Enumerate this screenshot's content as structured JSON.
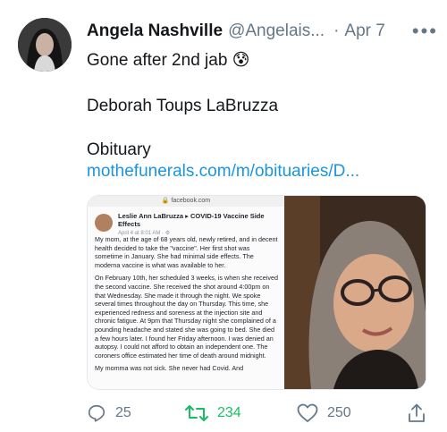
{
  "tweet": {
    "author_name": "Angela Nashville",
    "author_handle": "@Angelais...",
    "separator": "·",
    "date": "Apr 7",
    "more_label": "•••",
    "line1": "Gone after 2nd jab 😰",
    "line2": "Deborah Toups LaBruzza",
    "line3": "Obituary",
    "link_text": "mothefunerals.com/m/obituaries/D..."
  },
  "card": {
    "screenshot": {
      "url_bar": "facebook.com",
      "post_author": "Leslie Ann LaBruzza ▸ COVID-19 Vaccine Side Effects",
      "post_date": "April 4 at 8:01 AM · ⚙",
      "paragraphs": [
        "My mom, at the age of 68 years old, newly retired, and in decent health decided to take the \"vaccine\". Her first shot was sometime in January. She had minimal side effects. The moderna vaccine is what was available to her.",
        "On February 10th, her scheduled 3 weeks, is when she received the second vaccine. She received the shot around 4:00pm on that Wednesday. She made it through the night. We spoke several times throughout the day on Thursday. This time, she experienced redness and soreness at the injection site and chronic fatigue. At 9pm that Thursday night she complained of a pounding headache and stated she was going to bed. She died a few hours later. I found her Friday afternoon. I was denied an autopsy. I could not afford to obtain an independent one. The coroners office estimated her time of death around midnight.",
        "My momma was not sick. She never had Covid. And"
      ]
    }
  },
  "actions": {
    "reply_count": "25",
    "retweet_count": "234",
    "like_count": "250"
  },
  "colors": {
    "link": "#1b95e0",
    "retweet": "#17bf63",
    "muted": "#657786"
  }
}
